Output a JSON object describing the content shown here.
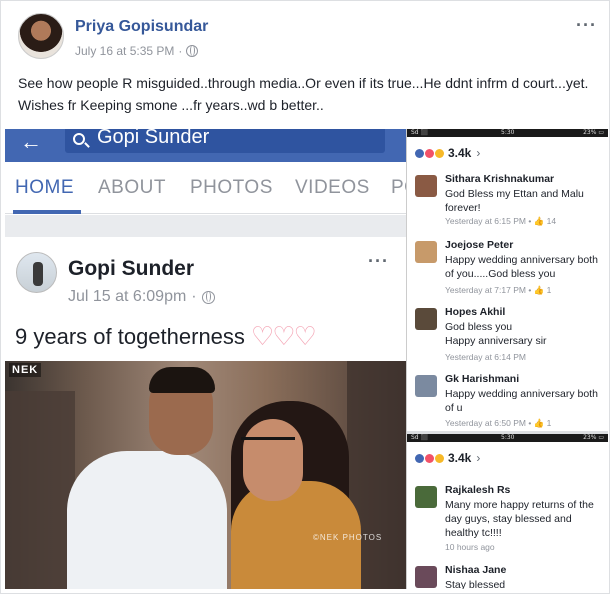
{
  "post": {
    "author": "Priya Gopisundar",
    "timestamp": "July 16 at 5:35 PM",
    "dot": "·",
    "text": "See how people R misguided..through media..Or even if its true...He ddnt infrm d court...yet. Wishes fr Keeping smone ...fr years..wd b better..",
    "more": "···"
  },
  "left_screenshot": {
    "search_text": "Gopi Sunder",
    "back_icon": "←",
    "tabs": [
      "HOME",
      "ABOUT",
      "PHOTOS",
      "VIDEOS",
      "PO"
    ],
    "active_tab": "HOME",
    "brand_color": "#4267b2",
    "inner_post": {
      "author": "Gopi Sunder",
      "timestamp": "Jul 15 at 6:09pm",
      "dot": "·",
      "text": "9 years of togetherness",
      "hearts": "♡♡♡",
      "more": "···",
      "photo_logo": "NEK",
      "photo_watermark": "©NEK PHOTOS"
    }
  },
  "right_top": {
    "status_left": "Sd ⬛",
    "status_center": "5:30",
    "status_right": "23% ▭",
    "reaction_count": "3.4k",
    "chevron": "›",
    "comments": [
      {
        "name": "Sithara Krishnakumar",
        "body": "God Bless my Ettan and Malu forever!",
        "meta": "Yesterday at 6:15 PM  •  ",
        "likes": "14",
        "like_icon": "👍",
        "avatar_color": "#8a5a44"
      },
      {
        "name": "Joejose Peter",
        "body": "Happy wedding anniversary both of you.....God bless you",
        "meta": "Yesterday at 7:17 PM  •  ",
        "likes": "1",
        "like_icon": "👍",
        "avatar_color": "#c79a6a"
      },
      {
        "name": "Hopes Akhil",
        "body": "God bless you\nHappy anniversary sir",
        "meta": "Yesterday at 6:14 PM",
        "likes": "",
        "like_icon": "",
        "avatar_color": "#5a4a3a"
      },
      {
        "name": "Gk Harishmani",
        "body": "Happy wedding anniversary both of u",
        "meta": "Yesterday at 6:50 PM  •  ",
        "likes": "1",
        "like_icon": "👍",
        "avatar_color": "#7b8aa0"
      }
    ]
  },
  "right_bottom": {
    "status_left": "Sd ⬛",
    "status_center": "5:30",
    "status_right": "23% ▭",
    "reaction_count": "3.4k",
    "chevron": "›",
    "comments": [
      {
        "name": "Rajkalesh Rs",
        "body": "Many more happy returns of the day guys, stay blessed and healthy tc!!!!",
        "meta": "10 hours ago",
        "avatar_color": "#4a6a3a"
      },
      {
        "name": "Nishaa Jane",
        "body": "Stay blessed",
        "meta": "",
        "avatar_color": "#6a4a5a"
      }
    ]
  }
}
